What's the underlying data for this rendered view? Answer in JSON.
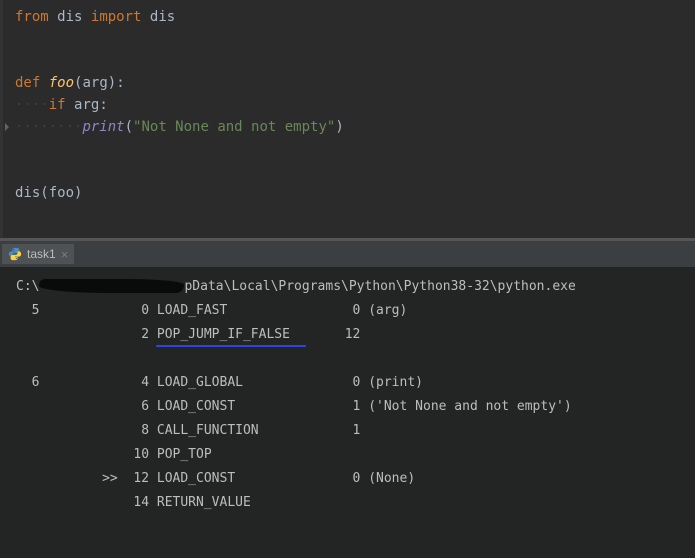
{
  "code": {
    "line1_from": "from",
    "line1_dis1": "dis",
    "line1_import": "import",
    "line1_dis2": "dis",
    "line_def": "def",
    "fn_name": "foo",
    "fn_arg": "arg",
    "if_kw": "if",
    "if_cond": "arg",
    "print_call": "print",
    "string_lit": "\"Not None and not empty\"",
    "dis_call": "dis",
    "dis_arg": "foo"
  },
  "tab": {
    "label": "task1"
  },
  "output": {
    "path_prefix": "C:\\",
    "path_suffix": "pData\\Local\\Programs\\Python\\Python38-32\\python.exe",
    "rows": [
      {
        "src": "  5",
        "mark": "  ",
        "off": " 0",
        "op": "LOAD_FAST         ",
        "arg": " 0 (arg)"
      },
      {
        "src": "   ",
        "mark": "  ",
        "off": " 2",
        "op": "POP_JUMP_IF_FALSE ",
        "arg": "12"
      },
      {
        "blank": true
      },
      {
        "src": "  6",
        "mark": "  ",
        "off": " 4",
        "op": "LOAD_GLOBAL       ",
        "arg": " 0 (print)"
      },
      {
        "src": "   ",
        "mark": "  ",
        "off": " 6",
        "op": "LOAD_CONST        ",
        "arg": " 1 ('Not None and not empty')"
      },
      {
        "src": "   ",
        "mark": "  ",
        "off": " 8",
        "op": "CALL_FUNCTION     ",
        "arg": " 1"
      },
      {
        "src": "   ",
        "mark": "  ",
        "off": "10",
        "op": "POP_TOP           ",
        "arg": ""
      },
      {
        "src": "   ",
        "mark": ">>",
        "off": "12",
        "op": "LOAD_CONST        ",
        "arg": " 0 (None)"
      },
      {
        "src": "   ",
        "mark": "  ",
        "off": "14",
        "op": "RETURN_VALUE      ",
        "arg": ""
      }
    ]
  }
}
